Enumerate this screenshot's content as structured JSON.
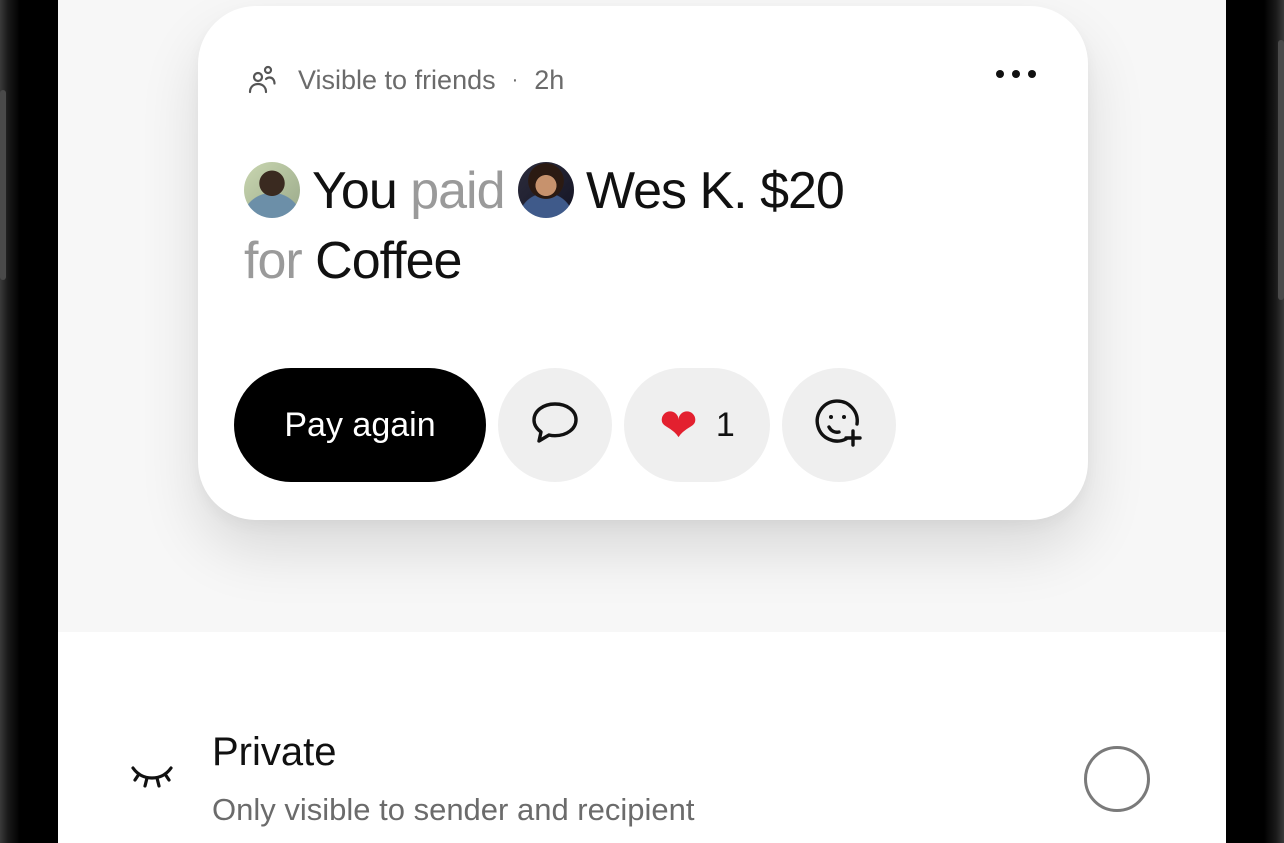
{
  "post": {
    "visibility": "Visible to friends",
    "separator": "·",
    "time": "2h",
    "subject": "You",
    "verb": "paid",
    "recipient": "Wes K.",
    "amount": "$20",
    "for_word": "for",
    "note": "Coffee"
  },
  "actions": {
    "pay_again_label": "Pay again",
    "like_count": "1"
  },
  "option": {
    "title": "Private",
    "subtitle": "Only visible to sender and recipient",
    "selected": false
  },
  "icons": {
    "visibility": "friends-icon",
    "more": "more-horizontal-icon",
    "comment": "speech-bubble-icon",
    "like": "heart-icon",
    "reaction": "add-emoji-icon",
    "private": "closed-eye-icon"
  },
  "colors": {
    "primary_button": "#000000",
    "heart": "#e3202f",
    "muted_text": "#9a9a9a"
  }
}
